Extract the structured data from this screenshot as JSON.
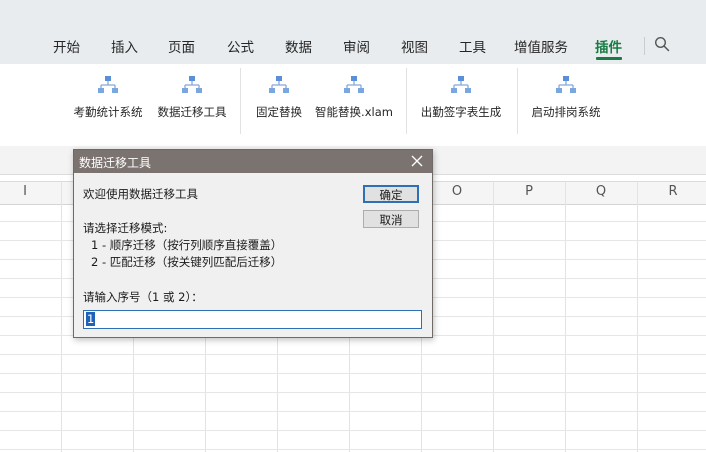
{
  "menu": {
    "items": [
      {
        "label": "开始"
      },
      {
        "label": "插入"
      },
      {
        "label": "页面"
      },
      {
        "label": "公式"
      },
      {
        "label": "数据"
      },
      {
        "label": "审阅"
      },
      {
        "label": "视图"
      },
      {
        "label": "工具"
      },
      {
        "label": "增值服务"
      },
      {
        "label": "插件"
      }
    ],
    "active": "插件"
  },
  "ribbon": {
    "buttons": [
      {
        "label": "考勤统计系统",
        "icon": "org-chart-icon"
      },
      {
        "label": "数据迁移工具",
        "icon": "org-chart-icon"
      },
      {
        "label": "固定替换",
        "icon": "org-chart-icon"
      },
      {
        "label": "智能替换.xlam",
        "icon": "org-chart-icon"
      },
      {
        "label": "出勤签字表生成",
        "icon": "org-chart-icon"
      },
      {
        "label": "启动排岗系统",
        "icon": "org-chart-icon"
      }
    ]
  },
  "grid": {
    "columns": [
      "I",
      "O",
      "P",
      "Q",
      "R"
    ]
  },
  "dialog": {
    "title": "数据迁移工具",
    "welcome": "欢迎使用数据迁移工具",
    "prompt_mode": "请选择迁移模式:",
    "option1": "1 - 顺序迁移（按行列顺序直接覆盖）",
    "option2": "2 - 匹配迁移（按关键列匹配后迁移）",
    "prompt_input": "请输入序号（1 或 2）：",
    "ok_label": "确定",
    "cancel_label": "取消",
    "input_value": "1"
  },
  "colors": {
    "accent": "#177b43",
    "dialog_title_bg": "#7b7370",
    "focus_blue": "#2f6fb5"
  }
}
